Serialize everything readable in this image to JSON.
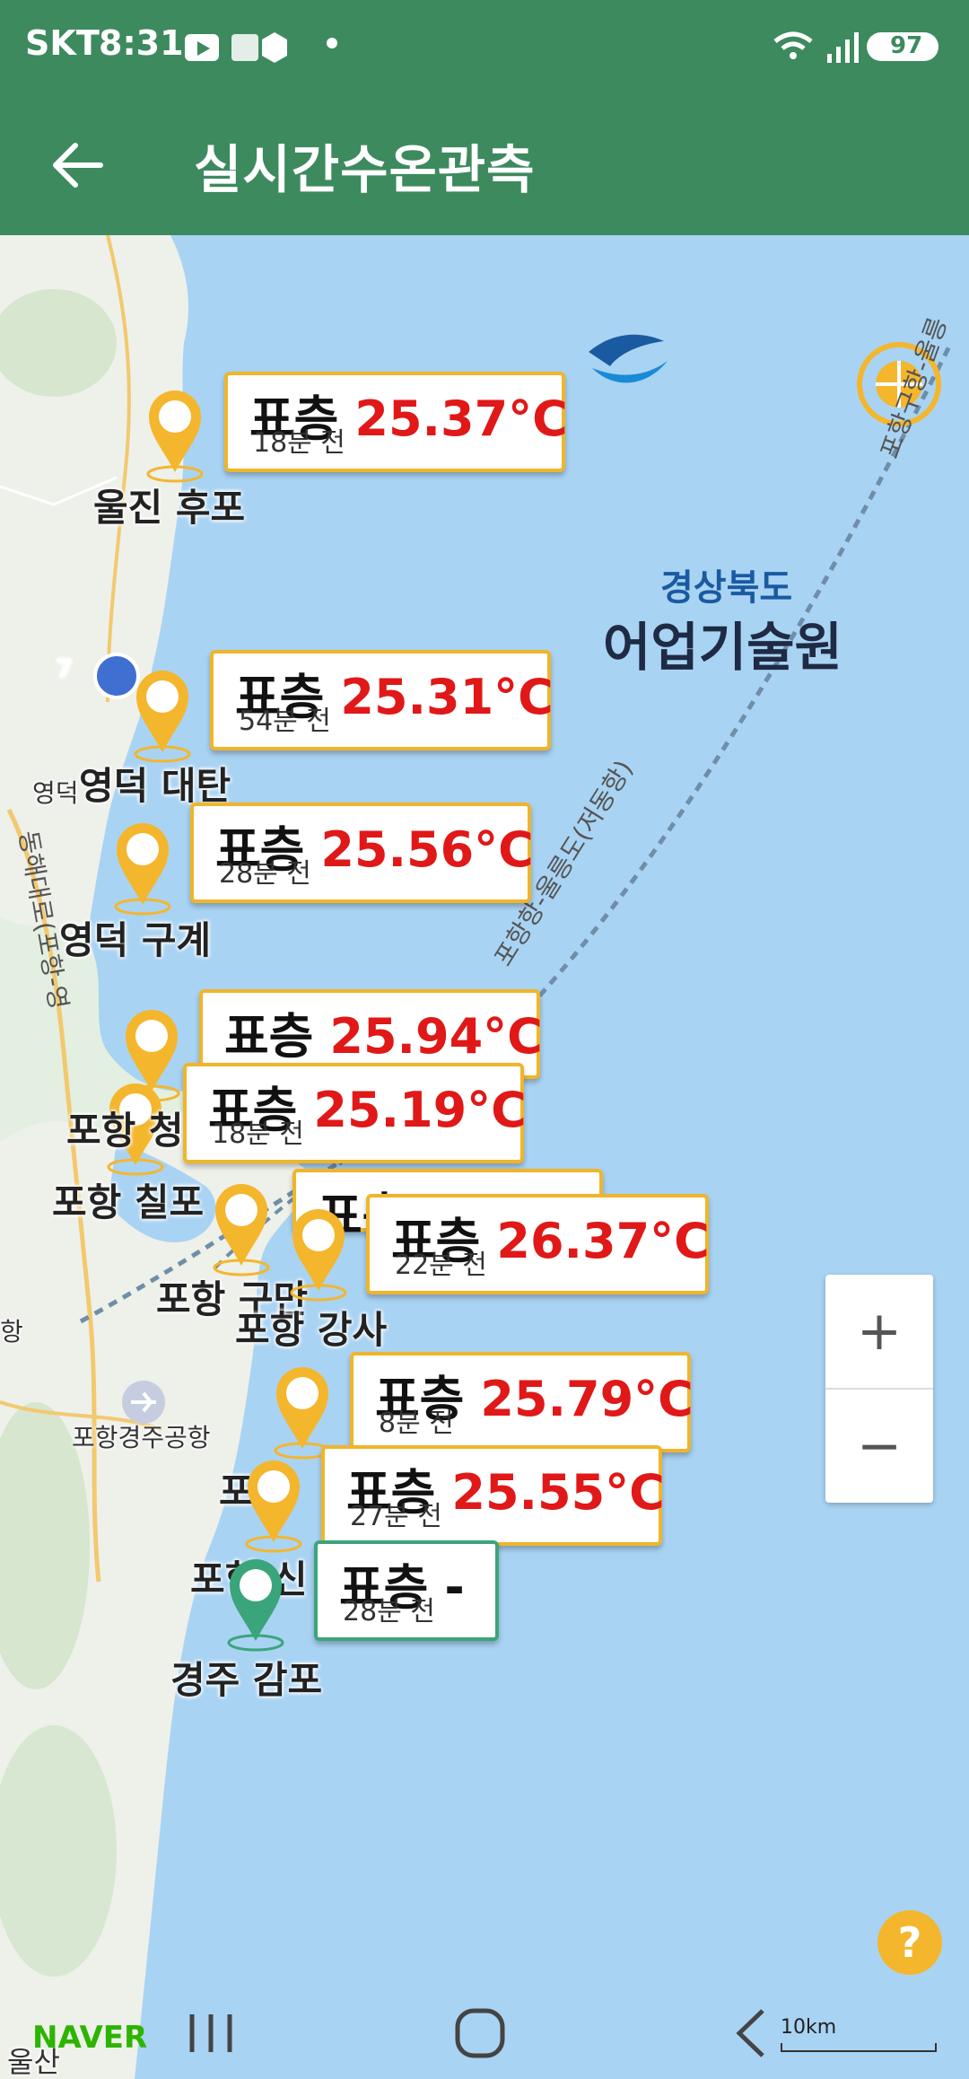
{
  "status_bar": {
    "carrier": "SKT",
    "time": "8:31",
    "battery": "97"
  },
  "app_bar": {
    "title": "실시간수온관측"
  },
  "logo": {
    "sub": "경상북도",
    "main": "어업기술원"
  },
  "map": {
    "route_label": "포항항-울릉도(저동항)",
    "route_label_2": "포항구항-울릉",
    "airport": "포항경주공항",
    "road_label": "동해대로(포항-영",
    "highway_number": "7",
    "small_labels": [
      "영덕",
      "항",
      "울산"
    ]
  },
  "stations": [
    {
      "name": "울진 후포",
      "label": "표층",
      "value": "25.37°C",
      "ago": "18분 전"
    },
    {
      "name": "영덕 대탄",
      "label": "표층",
      "value": "25.31°C",
      "ago": "54분 전"
    },
    {
      "name": "영덕 구계",
      "label": "표층",
      "value": "25.56°C",
      "ago": "28분 전"
    },
    {
      "name": "",
      "label": "표층",
      "value": "25.94°C",
      "ago": ""
    },
    {
      "name": "포항 청",
      "label": "표층",
      "value": "25.19°C",
      "ago": "18분 전"
    },
    {
      "name": "포항 칠포",
      "label": "표층",
      "value": "",
      "ago": ""
    },
    {
      "name": "포항 구만",
      "label": "",
      "value": "",
      "ago": ""
    },
    {
      "name": "포항 강사",
      "label": "표층",
      "value": "26.37°C",
      "ago": "22분 전"
    },
    {
      "name": "포",
      "label": "표층",
      "value": "25.79°C",
      "ago": "8분 전"
    },
    {
      "name": "포항",
      "label": "표층",
      "value": "25.55°C",
      "ago": "27분 전"
    },
    {
      "name": "포항 신",
      "label": "표층",
      "value": "-",
      "ago": "28분 전"
    },
    {
      "name": "경주 감포",
      "label": "",
      "value": "",
      "ago": ""
    }
  ],
  "controls": {
    "zoom_in": "+",
    "zoom_out": "−",
    "help": "?"
  },
  "attribution": {
    "naver": "NAVER",
    "scale": "10km"
  },
  "colors": {
    "app_bar": "#3d8a5e",
    "marker": "#f4b62d",
    "marker_green": "#3aa57a",
    "value_red": "#e01818",
    "sea": "#a9d3f3",
    "land": "#eef0ea"
  },
  "icons": [
    "back-arrow-icon",
    "zoom-in-icon",
    "zoom-out-icon",
    "help-icon",
    "map-marker-icon",
    "airport-icon",
    "wifi-icon",
    "signal-icon",
    "battery-icon"
  ]
}
